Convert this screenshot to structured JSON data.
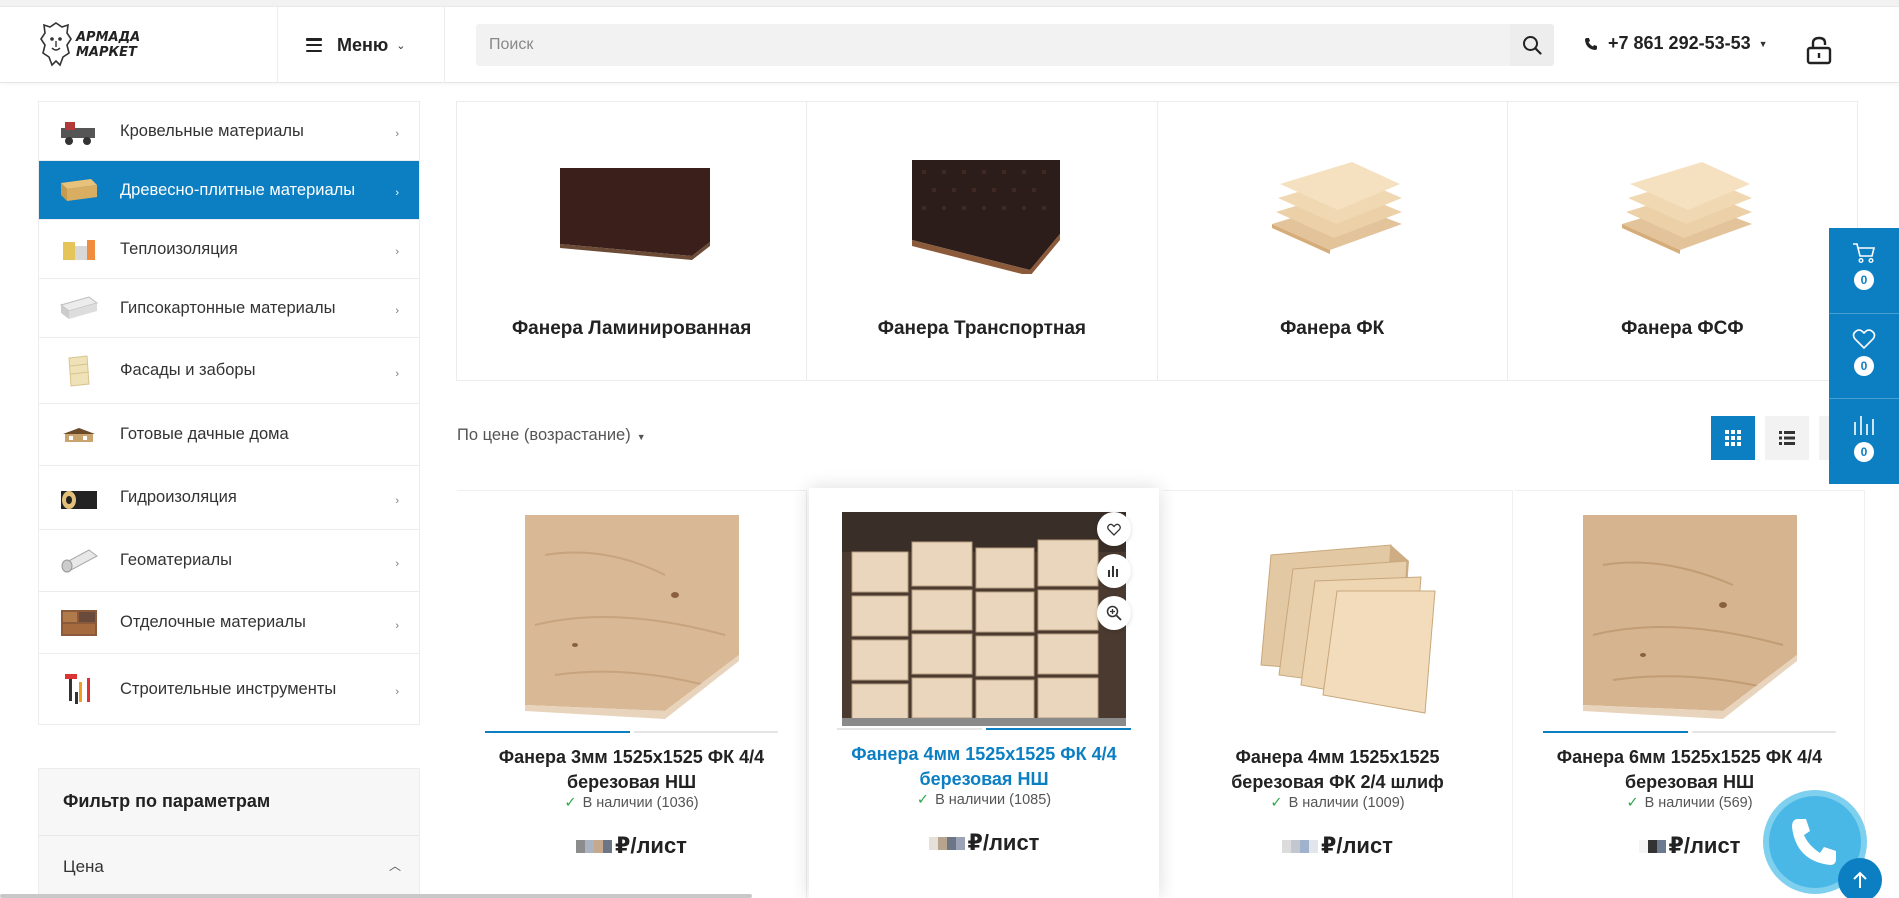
{
  "header": {
    "logo_text_line1": "АРМАДА",
    "logo_text_line2": "МАРКЕТ",
    "menu_label": "Меню",
    "search_placeholder": "Поиск",
    "phone": "+7 861 292-53-53"
  },
  "sidebar": {
    "items": [
      {
        "label": "Кровельные материалы",
        "icon": "roofing-thumb",
        "active": false,
        "has_arrow": true
      },
      {
        "label": "Древесно-плитные материалы",
        "icon": "wood-panels-thumb",
        "active": true,
        "has_arrow": true
      },
      {
        "label": "Теплоизоляция",
        "icon": "insulation-thumb",
        "active": false,
        "has_arrow": true
      },
      {
        "label": "Гипсокартонные материалы",
        "icon": "drywall-thumb",
        "active": false,
        "has_arrow": true
      },
      {
        "label": "Фасады и заборы",
        "icon": "facade-thumb",
        "active": false,
        "has_arrow": true
      },
      {
        "label": "Готовые дачные дома",
        "icon": "house-thumb",
        "active": false,
        "has_arrow": false
      },
      {
        "label": "Гидроизоляция",
        "icon": "waterproofing-thumb",
        "active": false,
        "has_arrow": true
      },
      {
        "label": "Геоматериалы",
        "icon": "geotextile-thumb",
        "active": false,
        "has_arrow": true
      },
      {
        "label": "Отделочные материалы",
        "icon": "finishing-thumb",
        "active": false,
        "has_arrow": true
      },
      {
        "label": "Строительные инструменты",
        "icon": "tools-thumb",
        "active": false,
        "has_arrow": true
      }
    ]
  },
  "filter": {
    "title": "Фильтр по параметрам",
    "price_label": "Цена"
  },
  "subcategories": [
    {
      "title": "Фанера Ламинированная",
      "image": "laminated-plywood"
    },
    {
      "title": "Фанера Транспортная",
      "image": "transport-plywood"
    },
    {
      "title": "Фанера ФК",
      "image": "fk-plywood"
    },
    {
      "title": "Фанера ФСФ",
      "image": "fsf-plywood"
    }
  ],
  "sort": {
    "label": "По цене (возрастание)"
  },
  "products": [
    {
      "name_line1": "Фанера 3мм 1525х1525 ФК 4/4",
      "name_line2": "березовая НШ",
      "stock": "В наличии (1036)",
      "price_unit": "₽/лист"
    },
    {
      "name_line1": "Фанера 4мм 1525х1525 ФК 4/4",
      "name_line2": "березовая НШ",
      "stock": "В наличии (1085)",
      "price_unit": "₽/лист"
    },
    {
      "name_line1": "Фанера 4мм 1525х1525",
      "name_line2": "березовая ФК 2/4 шлиф",
      "stock": "В наличии (1009)",
      "price_unit": "₽/лист"
    },
    {
      "name_line1": "Фанера 6мм 1525х1525 ФК 4/4",
      "name_line2": "березовая НШ",
      "stock": "В наличии (569)",
      "price_unit": "₽/лист"
    }
  ],
  "right_panel": {
    "cart_count": "0",
    "favorites_count": "0",
    "compare_count": "0"
  },
  "colors": {
    "accent": "#0c7fc3",
    "in_stock": "#2ea84a",
    "callback": "#4ab8e6"
  }
}
